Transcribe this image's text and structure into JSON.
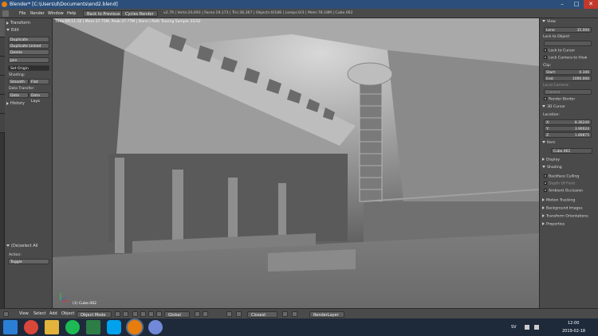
{
  "window": {
    "title": "Blender* [C:\\Users\\d\\Documents\\end2.blend]"
  },
  "menubar": {
    "items": [
      "File",
      "Render",
      "Window",
      "Help"
    ],
    "back_button": "Back to Previous",
    "engine": "Cycles Render",
    "stats": "v2.79 | Verts:20,693 | Faces:19,173 | Tris:36,367 | Objects:0/188 | Lamps:0/3 | Mem:78.18M | Cube.062"
  },
  "toolshelf": {
    "transform_panel": "Transform",
    "edit_panel": "Edit",
    "buttons": [
      "Duplicate",
      "Duplicate Linked",
      "Delete",
      "Join"
    ],
    "set_origin": "Set Origin",
    "shading_label": "Shading:",
    "smooth": "Smooth",
    "flat": "Flat",
    "data_transfer_label": "Data Transfer:",
    "data": "Data",
    "data_layout": "Data Layo",
    "history_panel": "History",
    "operator_panel": "(De)select All",
    "action_label": "Action:",
    "action_value": "Toggle"
  },
  "viewport": {
    "info": "Time:00:11.16 | Mem:37.75M, Peak:37.77M | Done | Path Tracing Sample 32/32",
    "object_label": "(1) Cube.062"
  },
  "properties": {
    "view_panel": "View",
    "lens_label": "Lens:",
    "lens_value": "35.000",
    "lock_to_object_label": "Lock to Object:",
    "lock_to_cursor": "Lock to Cursor",
    "lock_camera_to_view": "Lock Camera to View",
    "clip_label": "Clip:",
    "clip_start_label": "Start:",
    "clip_start_value": "0.100",
    "clip_end_label": "End:",
    "clip_end_value": "1000.000",
    "local_camera_label": "Local Camera:",
    "local_camera_value": "Camera",
    "render_border": "Render Border",
    "cursor_panel": "3D Cursor",
    "location_label": "Location:",
    "x_label": "X:",
    "x_value": "8.36240",
    "y_label": "Y:",
    "y_value": "3.90024",
    "z_label": "Z:",
    "z_value": "1.89875",
    "item_panel": "Item",
    "item_name": "Cube.062",
    "display_panel": "Display",
    "shading_panel": "Shading",
    "backface_culling": "Backface Culling",
    "depth_of_field": "Depth Of Field",
    "ambient_occlusion": "Ambient Occlusion",
    "motion_tracking": "Motion Tracking",
    "background_images": "Background Images",
    "transform_orientations": "Transform Orientations",
    "properties_panel": "Properties"
  },
  "bottombar": {
    "menus": [
      "View",
      "Select",
      "Add",
      "Object"
    ],
    "mode": "Object Mode",
    "orientation": "Global",
    "proportional": "Closest",
    "render_layer": "RenderLayer"
  },
  "taskbar": {
    "lang": "SV",
    "time": "12:00",
    "date": "2019-02-18"
  },
  "colors": {
    "titlebar": "#2b4f7a",
    "panel_bg": "#4a4a4a",
    "viewport_bg": "#6f6f6f",
    "accent_orange": "#e87d0d"
  }
}
